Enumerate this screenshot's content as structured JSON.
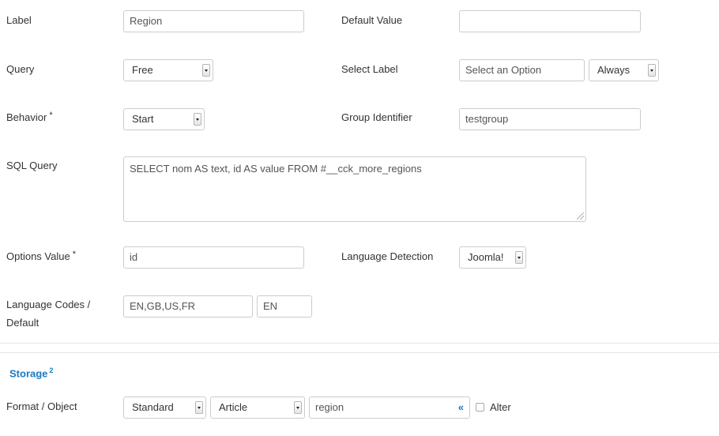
{
  "fields": {
    "label": {
      "label": "Label",
      "value": "Region"
    },
    "default_value": {
      "label": "Default Value",
      "value": ""
    },
    "query": {
      "label": "Query",
      "value": "Free"
    },
    "select_label": {
      "label": "Select Label",
      "value": "Select an Option",
      "mode": "Always"
    },
    "behavior": {
      "label": "Behavior",
      "required_mark": "*",
      "value": "Start"
    },
    "group_identifier": {
      "label": "Group Identifier",
      "value": "testgroup"
    },
    "sql_query": {
      "label": "SQL Query",
      "value": "SELECT nom AS text, id AS value FROM #__cck_more_regions"
    },
    "options_value": {
      "label": "Options Value",
      "required_mark": "*",
      "value": "id"
    },
    "language_detection": {
      "label": "Language Detection",
      "value": "Joomla!"
    },
    "language_codes": {
      "label_line1": "Language Codes /",
      "label_line2": "Default",
      "codes": "EN,GB,US,FR",
      "default": "EN"
    }
  },
  "storage": {
    "title": "Storage",
    "title_sup": "2",
    "format_object": {
      "label": "Format / Object",
      "format": "Standard",
      "object": "Article",
      "field": "region",
      "chevron": "«",
      "alter_label": "Alter",
      "alter_checked": false
    }
  }
}
